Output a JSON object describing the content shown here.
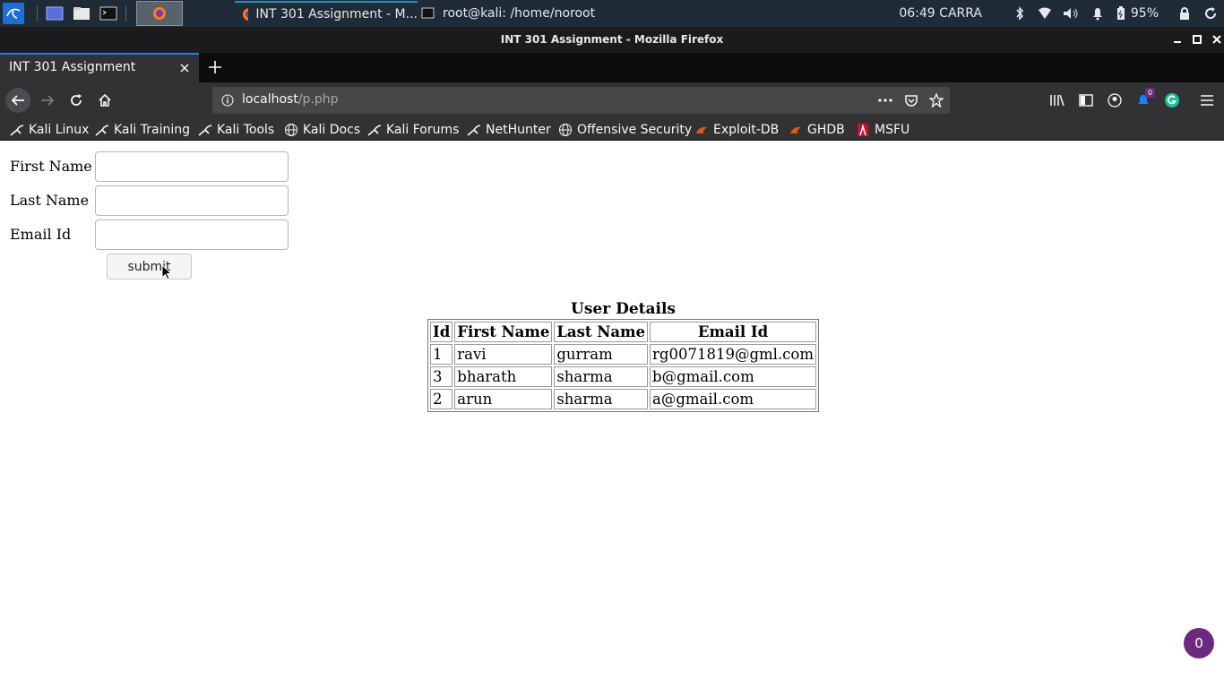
{
  "taskbar": {
    "active_task_title": "INT 301 Assignment - M...",
    "terminal_task_title": "root@kali: /home/noroot",
    "clock": "06:49",
    "keyboard_layout": "CARRA",
    "battery": "95%"
  },
  "window": {
    "title": "INT 301 Assignment - Mozilla Firefox"
  },
  "tab": {
    "title": "INT 301 Assignment"
  },
  "urlbar": {
    "host": "localhost",
    "path": "/p.php"
  },
  "toolbar": {
    "notification_count": "0"
  },
  "bookmarks": [
    {
      "label": "Kali Linux",
      "icon": "kali-dragon-icon"
    },
    {
      "label": "Kali Training",
      "icon": "kali-dragon-icon"
    },
    {
      "label": "Kali Tools",
      "icon": "kali-dragon-icon"
    },
    {
      "label": "Kali Docs",
      "icon": "globe-icon"
    },
    {
      "label": "Kali Forums",
      "icon": "kali-dragon-icon"
    },
    {
      "label": "NetHunter",
      "icon": "kali-dragon-icon"
    },
    {
      "label": "Offensive Security",
      "icon": "globe-icon"
    },
    {
      "label": "Exploit-DB",
      "icon": "exploit-db-icon"
    },
    {
      "label": "GHDB",
      "icon": "exploit-db-icon"
    },
    {
      "label": "MSFU",
      "icon": "msfu-icon"
    }
  ],
  "form": {
    "first_name_label": "First Name",
    "last_name_label": "Last Name",
    "email_label": "Email Id",
    "first_name_value": "",
    "last_name_value": "",
    "email_value": "",
    "submit_label": "submit"
  },
  "table": {
    "caption": "User Details",
    "headers": [
      "Id",
      "First Name",
      "Last Name",
      "Email Id"
    ],
    "rows": [
      [
        "1",
        "ravi",
        "gurram",
        "rg0071819@gml.com"
      ],
      [
        "3",
        "bharath",
        "sharma",
        "b@gmail.com"
      ],
      [
        "2",
        "arun",
        "sharma",
        "a@gmail.com"
      ]
    ]
  },
  "grammarly_badge": "0",
  "colors": {
    "taskbar_bg": "#1f2c37",
    "toolbar_bg": "#323234",
    "tab_accent": "#0a84ff",
    "grammarly_badge": "#6b2a7e"
  }
}
